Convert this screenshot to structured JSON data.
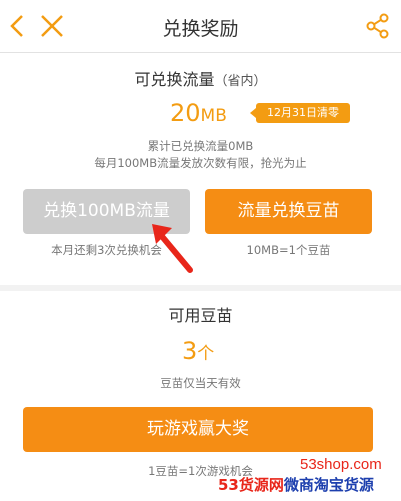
{
  "header": {
    "title": "兑换奖励",
    "icons": {
      "back": "chevron-left-icon",
      "close": "close-icon",
      "share": "share-icon"
    }
  },
  "traffic": {
    "title": "可兑换流量",
    "title_suffix": "（省内）",
    "amount": "20",
    "unit": "MB",
    "deadline_badge": "12月31日清零",
    "note_line1": "累计已兑换流量0MB",
    "note_line2": "每月100MB流量发放次数有限，抢光为止",
    "exchange_button": "兑换100MB流量",
    "exchange_sub": "本月还剩3次兑换机会",
    "convert_button": "流量兑换豆苗",
    "convert_sub": "10MB=1个豆苗"
  },
  "seedlings": {
    "title": "可用豆苗",
    "count": "3",
    "unit": "个",
    "note": "豆苗仅当天有效",
    "play_button": "玩游戏赢大奖",
    "play_sub": "1豆苗=1次游戏机会"
  },
  "watermark": {
    "url": "53shop.com",
    "brand_red": "53货源网",
    "brand_blue": "微商淘宝货源"
  },
  "colors": {
    "accent": "#f58d14",
    "disabled": "#cdcdcd",
    "annotation_arrow": "#e8261a"
  }
}
